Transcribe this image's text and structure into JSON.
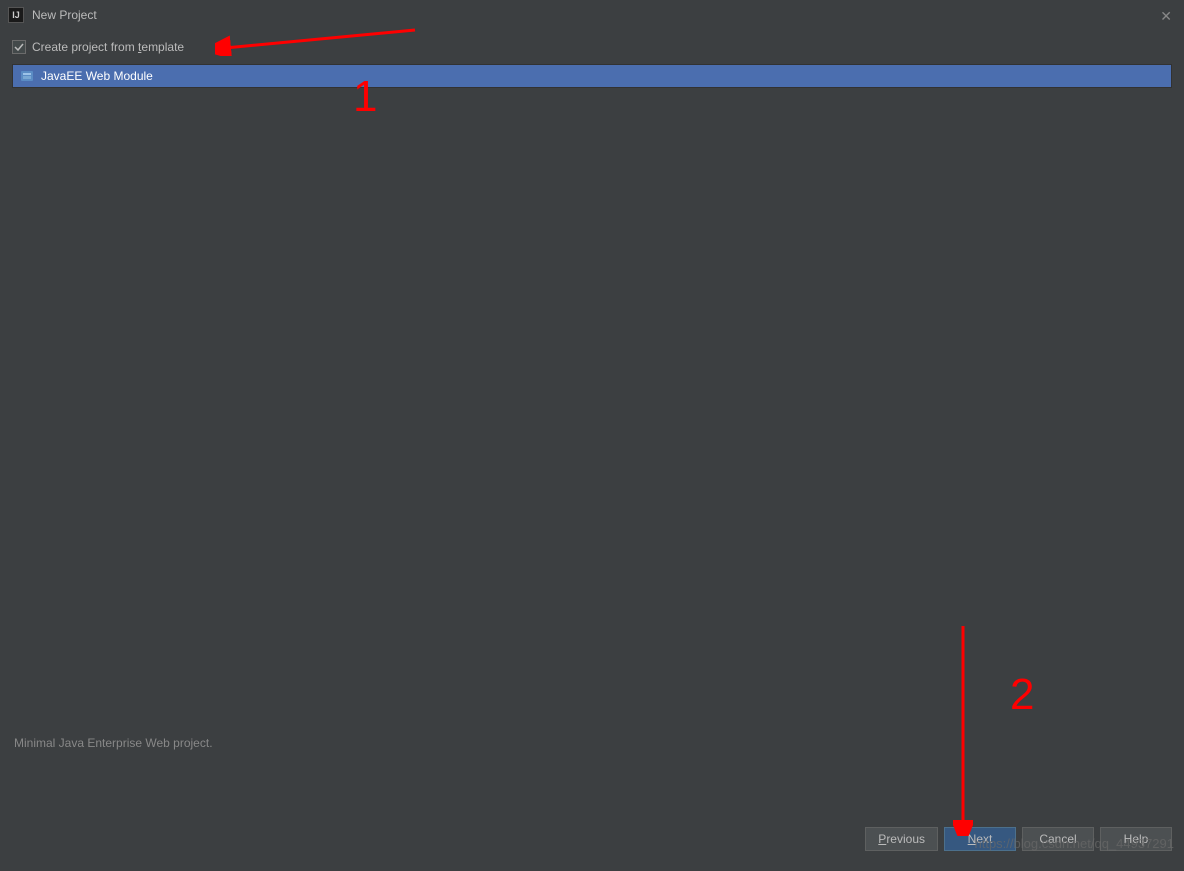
{
  "window": {
    "title": "New Project",
    "app_icon_text": "IJ"
  },
  "checkbox": {
    "label_prefix": "Create project from ",
    "label_underline": "t",
    "label_suffix": "emplate",
    "checked": true
  },
  "template_list": {
    "items": [
      {
        "label": "JavaEE Web Module",
        "selected": true
      }
    ]
  },
  "description": "Minimal Java Enterprise Web project.",
  "buttons": {
    "previous": {
      "underline": "P",
      "rest": "revious"
    },
    "next": {
      "underline": "N",
      "rest": "ext"
    },
    "cancel": "Cancel",
    "help": "Help"
  },
  "annotations": {
    "label_1": "1",
    "label_2": "2"
  },
  "watermark": "https://blog.csdn.net/qq_44937291"
}
